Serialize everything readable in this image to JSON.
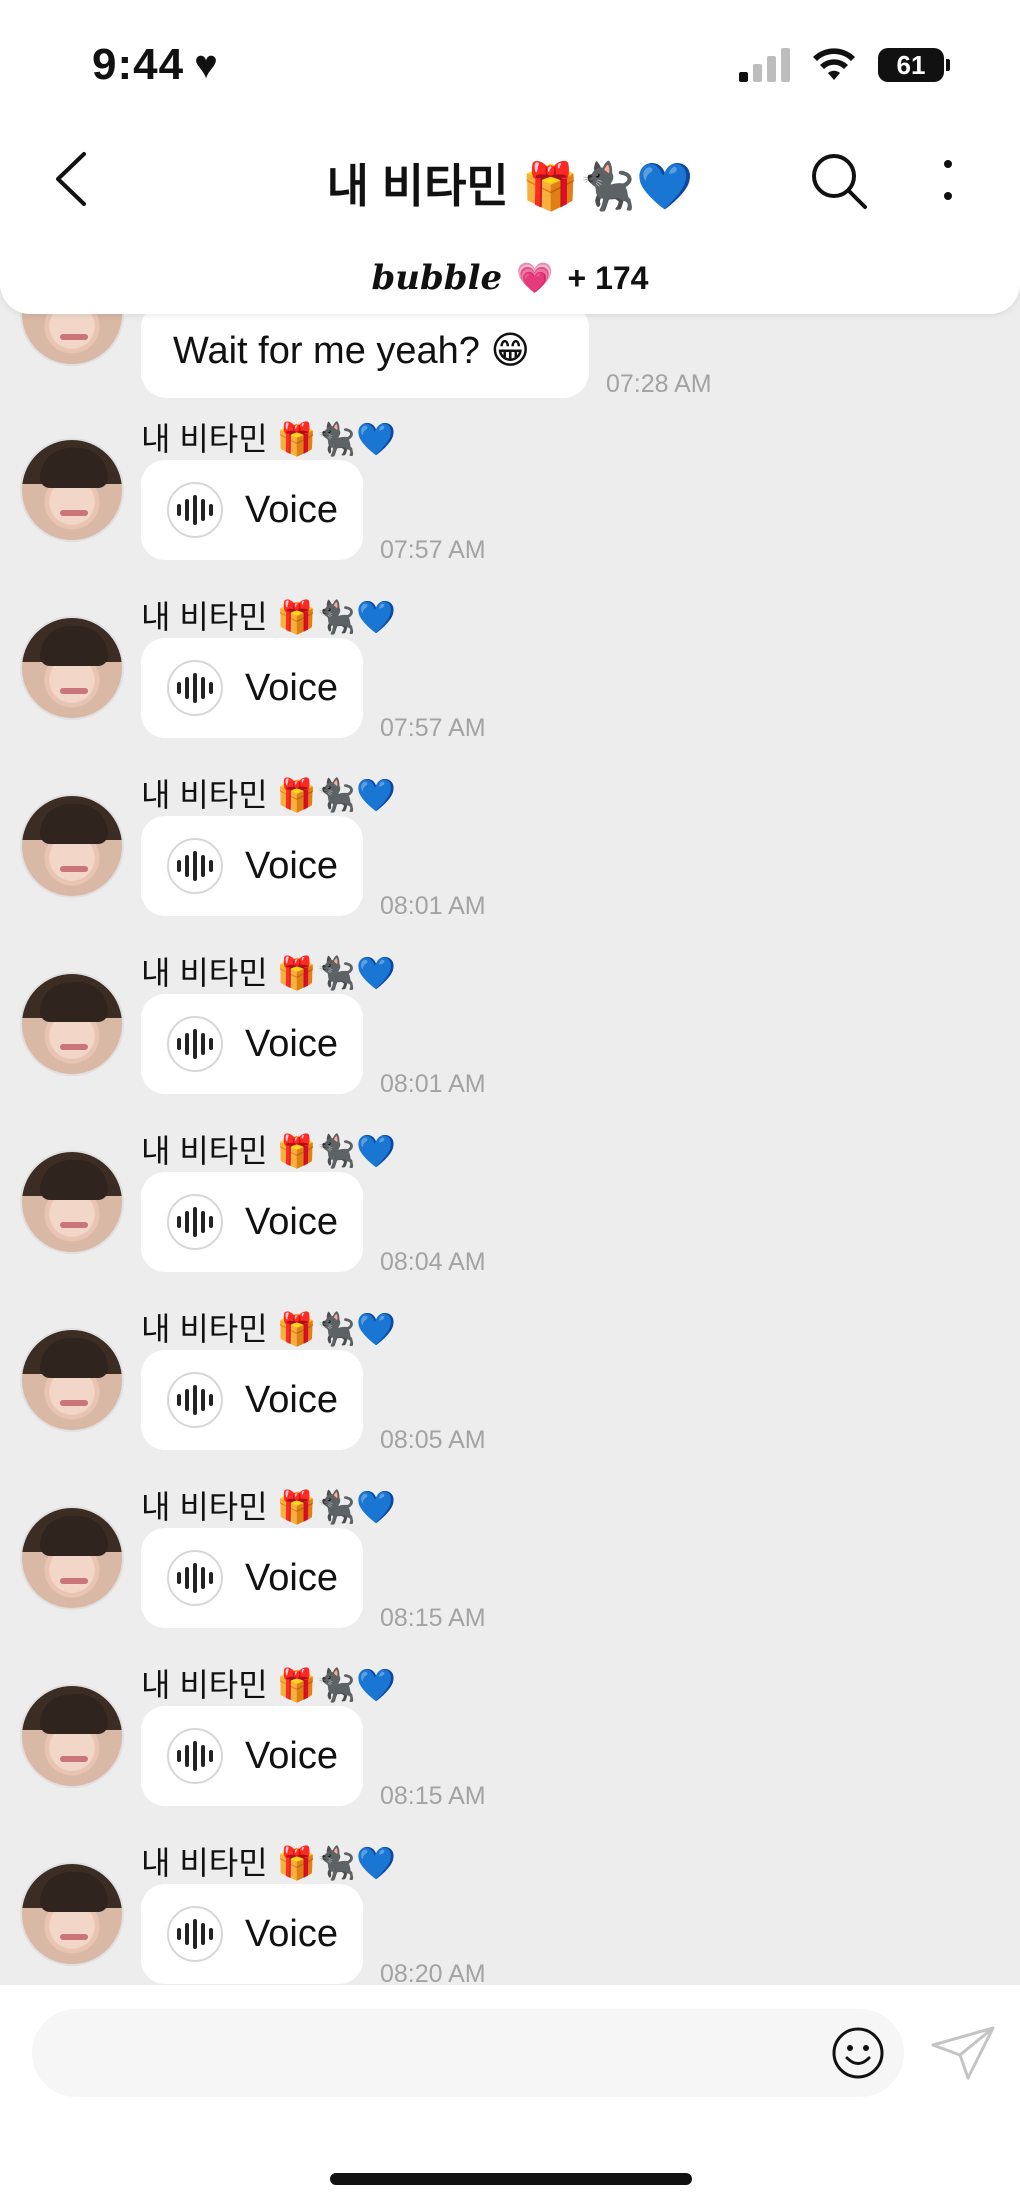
{
  "status_bar": {
    "time": "9:44",
    "heart": "♥",
    "battery": "61"
  },
  "header": {
    "title": "내 비타민 🎁🐈‍⬛💙",
    "bubble_logo": "bubble",
    "bubble_heart": "💗",
    "bubble_count": "+ 174"
  },
  "first_message": {
    "text": "Wait for me yeah? 😁",
    "time": "07:28 AM"
  },
  "messages": [
    {
      "sender": "내 비타민 🎁🐈‍⬛💙",
      "label": "Voice",
      "time": "07:57 AM"
    },
    {
      "sender": "내 비타민 🎁🐈‍⬛💙",
      "label": "Voice",
      "time": "07:57 AM"
    },
    {
      "sender": "내 비타민 🎁🐈‍⬛💙",
      "label": "Voice",
      "time": "08:01 AM"
    },
    {
      "sender": "내 비타민 🎁🐈‍⬛💙",
      "label": "Voice",
      "time": "08:01 AM"
    },
    {
      "sender": "내 비타민 🎁🐈‍⬛💙",
      "label": "Voice",
      "time": "08:04 AM"
    },
    {
      "sender": "내 비타민 🎁🐈‍⬛💙",
      "label": "Voice",
      "time": "08:05 AM"
    },
    {
      "sender": "내 비타민 🎁🐈‍⬛💙",
      "label": "Voice",
      "time": "08:15 AM"
    },
    {
      "sender": "내 비타민 🎁🐈‍⬛💙",
      "label": "Voice",
      "time": "08:15 AM"
    },
    {
      "sender": "내 비타민 🎁🐈‍⬛💙",
      "label": "Voice",
      "time": "08:20 AM"
    }
  ],
  "icons": {
    "back": "chevron-left-icon",
    "search": "search-icon",
    "more": "more-vertical-icon",
    "voice": "audio-wave-icon",
    "emoji": "smiley-icon",
    "send": "send-icon"
  },
  "colors": {
    "chat_background": "#ededed",
    "bubble": "#ffffff",
    "timestamp": "#a3a3a3"
  }
}
